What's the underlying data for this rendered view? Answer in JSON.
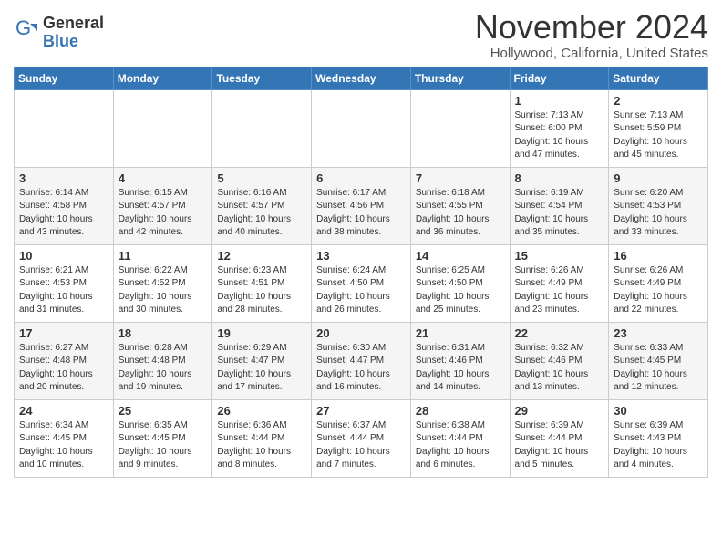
{
  "header": {
    "logo_general": "General",
    "logo_blue": "Blue",
    "month_title": "November 2024",
    "location": "Hollywood, California, United States"
  },
  "weekdays": [
    "Sunday",
    "Monday",
    "Tuesday",
    "Wednesday",
    "Thursday",
    "Friday",
    "Saturday"
  ],
  "weeks": [
    [
      {
        "day": "",
        "info": ""
      },
      {
        "day": "",
        "info": ""
      },
      {
        "day": "",
        "info": ""
      },
      {
        "day": "",
        "info": ""
      },
      {
        "day": "",
        "info": ""
      },
      {
        "day": "1",
        "info": "Sunrise: 7:13 AM\nSunset: 6:00 PM\nDaylight: 10 hours and 47 minutes."
      },
      {
        "day": "2",
        "info": "Sunrise: 7:13 AM\nSunset: 5:59 PM\nDaylight: 10 hours and 45 minutes."
      }
    ],
    [
      {
        "day": "3",
        "info": "Sunrise: 6:14 AM\nSunset: 4:58 PM\nDaylight: 10 hours and 43 minutes."
      },
      {
        "day": "4",
        "info": "Sunrise: 6:15 AM\nSunset: 4:57 PM\nDaylight: 10 hours and 42 minutes."
      },
      {
        "day": "5",
        "info": "Sunrise: 6:16 AM\nSunset: 4:57 PM\nDaylight: 10 hours and 40 minutes."
      },
      {
        "day": "6",
        "info": "Sunrise: 6:17 AM\nSunset: 4:56 PM\nDaylight: 10 hours and 38 minutes."
      },
      {
        "day": "7",
        "info": "Sunrise: 6:18 AM\nSunset: 4:55 PM\nDaylight: 10 hours and 36 minutes."
      },
      {
        "day": "8",
        "info": "Sunrise: 6:19 AM\nSunset: 4:54 PM\nDaylight: 10 hours and 35 minutes."
      },
      {
        "day": "9",
        "info": "Sunrise: 6:20 AM\nSunset: 4:53 PM\nDaylight: 10 hours and 33 minutes."
      }
    ],
    [
      {
        "day": "10",
        "info": "Sunrise: 6:21 AM\nSunset: 4:53 PM\nDaylight: 10 hours and 31 minutes."
      },
      {
        "day": "11",
        "info": "Sunrise: 6:22 AM\nSunset: 4:52 PM\nDaylight: 10 hours and 30 minutes."
      },
      {
        "day": "12",
        "info": "Sunrise: 6:23 AM\nSunset: 4:51 PM\nDaylight: 10 hours and 28 minutes."
      },
      {
        "day": "13",
        "info": "Sunrise: 6:24 AM\nSunset: 4:50 PM\nDaylight: 10 hours and 26 minutes."
      },
      {
        "day": "14",
        "info": "Sunrise: 6:25 AM\nSunset: 4:50 PM\nDaylight: 10 hours and 25 minutes."
      },
      {
        "day": "15",
        "info": "Sunrise: 6:26 AM\nSunset: 4:49 PM\nDaylight: 10 hours and 23 minutes."
      },
      {
        "day": "16",
        "info": "Sunrise: 6:26 AM\nSunset: 4:49 PM\nDaylight: 10 hours and 22 minutes."
      }
    ],
    [
      {
        "day": "17",
        "info": "Sunrise: 6:27 AM\nSunset: 4:48 PM\nDaylight: 10 hours and 20 minutes."
      },
      {
        "day": "18",
        "info": "Sunrise: 6:28 AM\nSunset: 4:48 PM\nDaylight: 10 hours and 19 minutes."
      },
      {
        "day": "19",
        "info": "Sunrise: 6:29 AM\nSunset: 4:47 PM\nDaylight: 10 hours and 17 minutes."
      },
      {
        "day": "20",
        "info": "Sunrise: 6:30 AM\nSunset: 4:47 PM\nDaylight: 10 hours and 16 minutes."
      },
      {
        "day": "21",
        "info": "Sunrise: 6:31 AM\nSunset: 4:46 PM\nDaylight: 10 hours and 14 minutes."
      },
      {
        "day": "22",
        "info": "Sunrise: 6:32 AM\nSunset: 4:46 PM\nDaylight: 10 hours and 13 minutes."
      },
      {
        "day": "23",
        "info": "Sunrise: 6:33 AM\nSunset: 4:45 PM\nDaylight: 10 hours and 12 minutes."
      }
    ],
    [
      {
        "day": "24",
        "info": "Sunrise: 6:34 AM\nSunset: 4:45 PM\nDaylight: 10 hours and 10 minutes."
      },
      {
        "day": "25",
        "info": "Sunrise: 6:35 AM\nSunset: 4:45 PM\nDaylight: 10 hours and 9 minutes."
      },
      {
        "day": "26",
        "info": "Sunrise: 6:36 AM\nSunset: 4:44 PM\nDaylight: 10 hours and 8 minutes."
      },
      {
        "day": "27",
        "info": "Sunrise: 6:37 AM\nSunset: 4:44 PM\nDaylight: 10 hours and 7 minutes."
      },
      {
        "day": "28",
        "info": "Sunrise: 6:38 AM\nSunset: 4:44 PM\nDaylight: 10 hours and 6 minutes."
      },
      {
        "day": "29",
        "info": "Sunrise: 6:39 AM\nSunset: 4:44 PM\nDaylight: 10 hours and 5 minutes."
      },
      {
        "day": "30",
        "info": "Sunrise: 6:39 AM\nSunset: 4:43 PM\nDaylight: 10 hours and 4 minutes."
      }
    ]
  ]
}
